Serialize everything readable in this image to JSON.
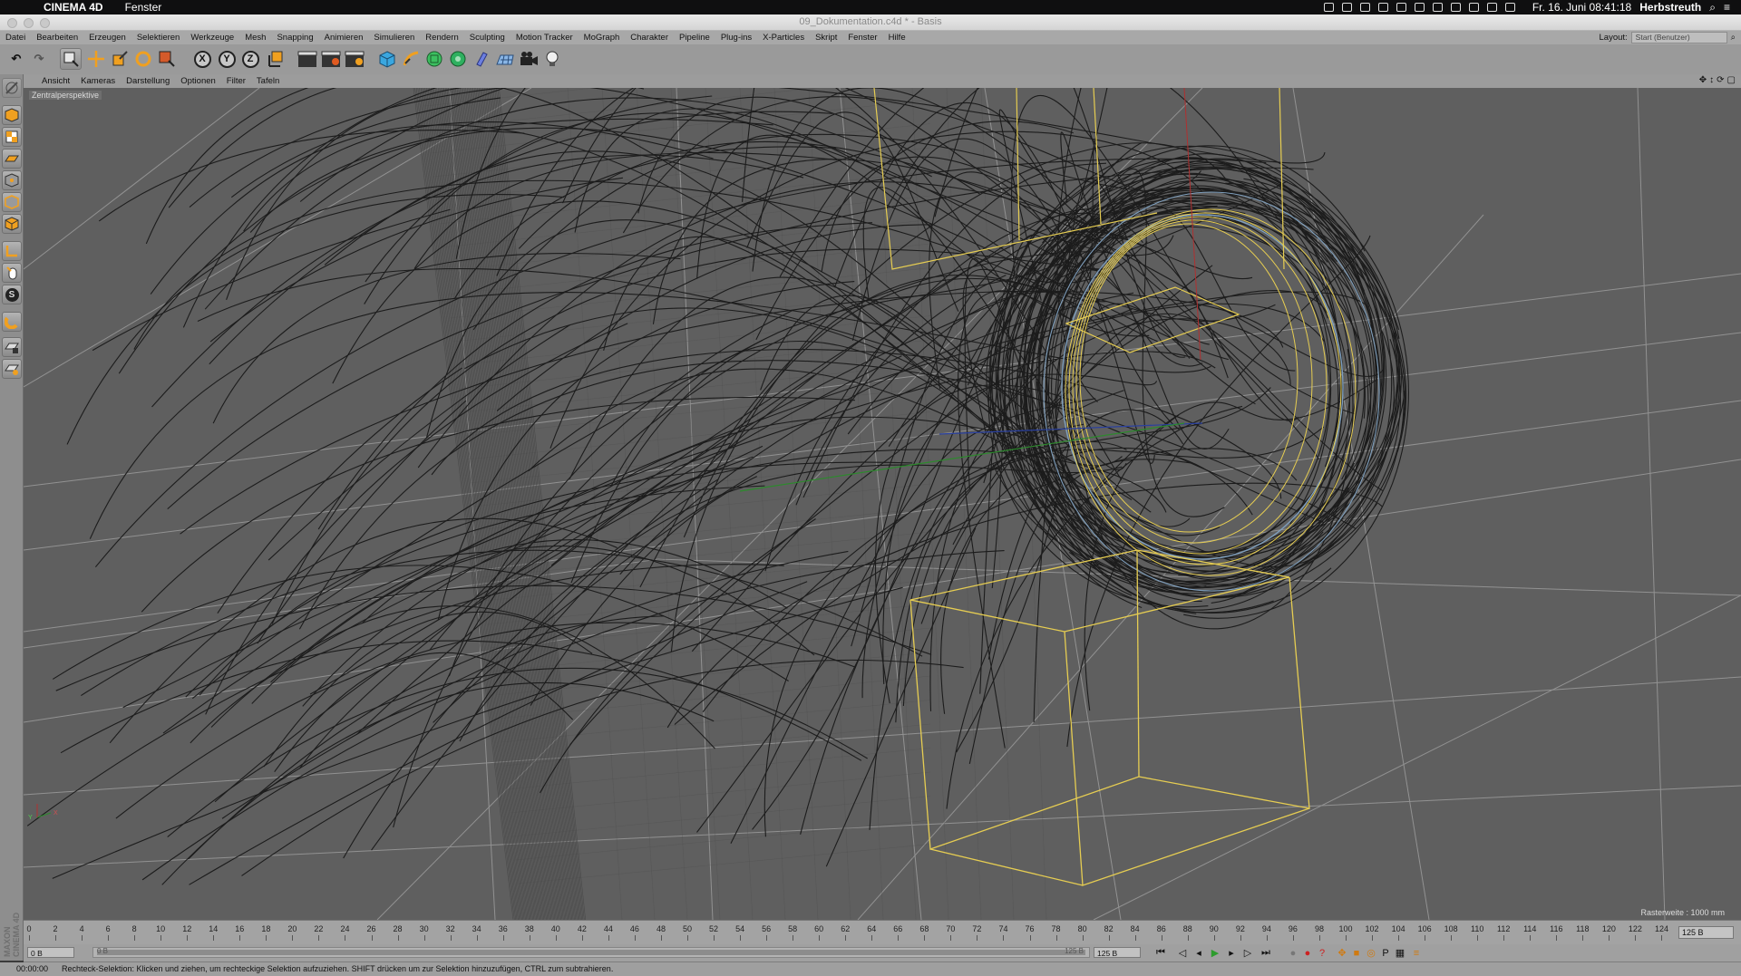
{
  "macmenu": {
    "app": "CINEMA 4D",
    "window_menu": "Fenster",
    "clock": "Fr. 16. Juni  08:41:18",
    "user": "Herbstreuth"
  },
  "window": {
    "title": "09_Dokumentation.c4d * - Basis"
  },
  "menu": {
    "items": [
      "Datei",
      "Bearbeiten",
      "Erzeugen",
      "Selektieren",
      "Werkzeuge",
      "Mesh",
      "Snapping",
      "Animieren",
      "Simulieren",
      "Rendern",
      "Sculpting",
      "Motion Tracker",
      "MoGraph",
      "Charakter",
      "Pipeline",
      "Plug-ins",
      "X-Particles",
      "Skript",
      "Fenster",
      "Hilfe"
    ],
    "layout_label": "Layout:",
    "layout_value": "Start (Benutzer)"
  },
  "toolbar": {
    "axis_x": "X",
    "axis_y": "Y",
    "axis_z": "Z",
    "accent": "#f0a020"
  },
  "leftbar": {
    "brand_maxon": "MAXON",
    "brand_product": "CINEMA 4D",
    "mode_s": "S"
  },
  "viewport": {
    "menu": [
      "Ansicht",
      "Kameras",
      "Darstellung",
      "Optionen",
      "Filter",
      "Tafeln"
    ],
    "camera_label": "Zentralperspektive",
    "grid_info": "Rasterweite : 1000 mm",
    "axis_x_label": "X",
    "axis_y_label": "Y",
    "colors": {
      "background": "#5f5f5f",
      "grid": "#a3a3a3",
      "hair": "#1c1c1c",
      "selection": "#e6cd52",
      "circle": "#7f9fbd"
    }
  },
  "timeline": {
    "ticks": [
      0,
      2,
      4,
      6,
      8,
      10,
      12,
      14,
      16,
      18,
      20,
      22,
      24,
      26,
      28,
      30,
      32,
      34,
      36,
      38,
      40,
      42,
      44,
      46,
      48,
      50,
      52,
      54,
      56,
      58,
      60,
      62,
      64,
      66,
      68,
      70,
      72,
      74,
      76,
      78,
      80,
      82,
      84,
      86,
      88,
      90,
      92,
      94,
      96,
      98,
      100,
      102,
      104,
      106,
      108,
      110,
      112,
      114,
      116,
      118,
      120,
      122,
      124
    ],
    "current_frame": "125 B"
  },
  "transport": {
    "start": "0 B",
    "slider_start": "0 B",
    "slider_end": "125 B",
    "end": "125 B"
  },
  "status": {
    "time": "00:00:00",
    "message": "Rechteck-Selektion: Klicken und ziehen, um rechteckige Selektion aufzuziehen. SHIFT drücken um zur Selektion hinzuzufügen, CTRL zum subtrahieren."
  }
}
